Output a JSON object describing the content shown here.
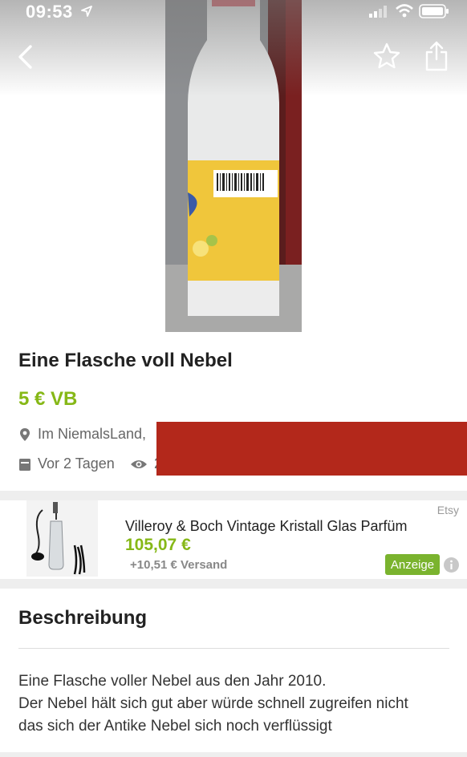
{
  "status": {
    "time": "09:53"
  },
  "listing": {
    "title": "Eine Flasche voll Nebel",
    "price": "5 € VB",
    "location": "Im NiemalsLand,",
    "posted": "Vor 2 Tagen",
    "views": "2"
  },
  "ad": {
    "source": "Etsy",
    "title": "Villeroy & Boch Vintage Kristall Glas Parfüm",
    "price": "105,07 €",
    "shipping": "+10,51 € Versand",
    "badge": "Anzeige"
  },
  "description": {
    "heading": "Beschreibung",
    "lines": [
      "Eine Flasche voller Nebel aus den Jahr 2010.",
      "Der Nebel hält sich gut aber würde schnell zugreifen nicht",
      "das sich der Antike Nebel sich noch verflüssigt"
    ]
  },
  "icons": {
    "back": "chevron-left-icon",
    "favorite": "star-icon",
    "share": "share-icon",
    "location": "location-pin-icon",
    "calendar": "calendar-icon",
    "views": "eye-icon",
    "info": "info-icon"
  },
  "colors": {
    "price": "#86b817",
    "badge": "#7ab32e",
    "redaction": "#b3281b"
  }
}
